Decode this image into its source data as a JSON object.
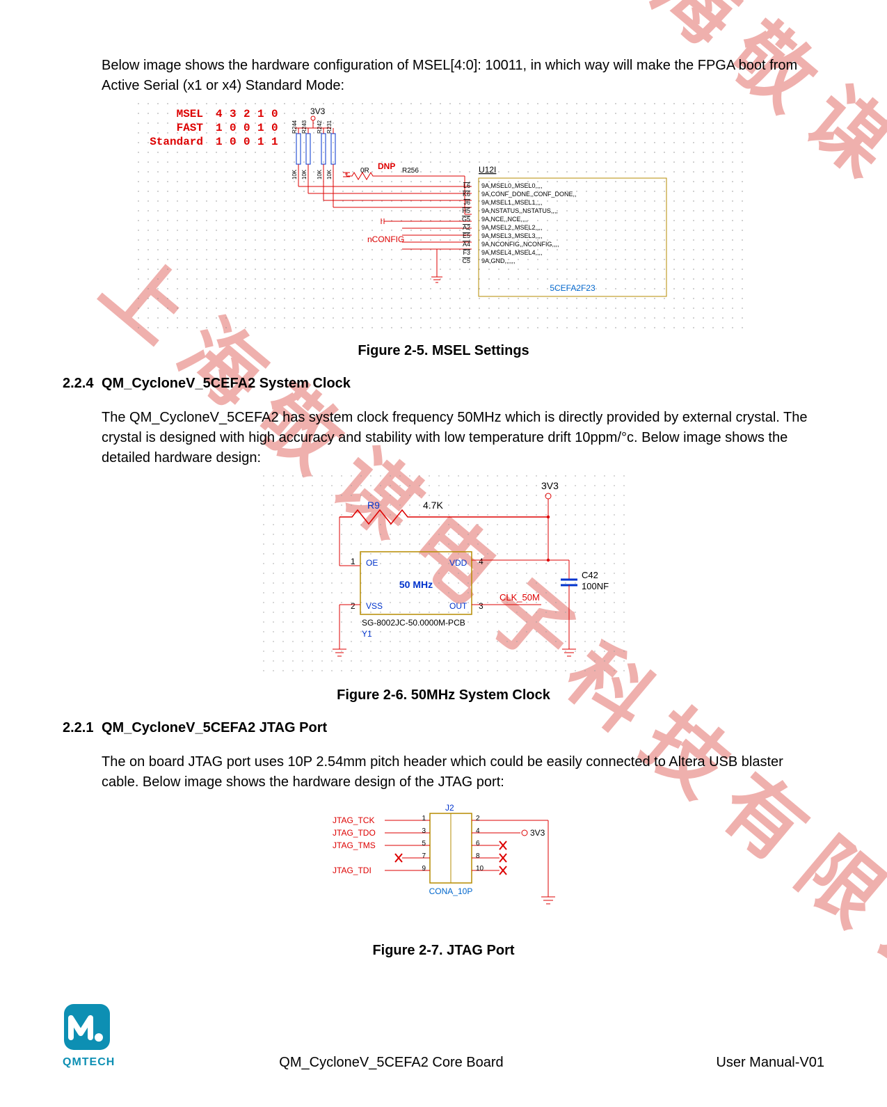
{
  "intro_paragraph": "Below image shows the hardware configuration of MSEL[4:0]: 10011, in which way will make the FPGA boot from Active Serial (x1 or x4) Standard Mode:",
  "msel_diagram": {
    "header": {
      "label": "MSEL",
      "bits": [
        "4",
        "3",
        "2",
        "1",
        "0"
      ]
    },
    "fast": {
      "label": "FAST",
      "bits": [
        "1",
        "0",
        "0",
        "1",
        "0"
      ]
    },
    "std": {
      "label": "Standard",
      "bits": [
        "1",
        "0",
        "0",
        "1",
        "1"
      ]
    },
    "rail": "3V3",
    "resistors": [
      "R244",
      "R243",
      "R242",
      "R231"
    ],
    "res_values": [
      "10K",
      "10K",
      "10K",
      "10K"
    ],
    "dnp_label": "DNP",
    "dnp_res_left": "0R",
    "dnp_res": "R256",
    "nconfig": "nCONFIG",
    "chip_ref": "U12I",
    "chip_pins": [
      {
        "pin": "L6",
        "net": "9A,MSEL0,,MSEL0,,,,"
      },
      {
        "pin": "K6",
        "net": "9A,CONF_DONE,,CONF_DONE,,"
      },
      {
        "pin": "J6",
        "net": "9A,MSEL1,,MSEL1,,,,"
      },
      {
        "pin": "H5",
        "net": "9A,NSTATUS,,NSTATUS,,,,"
      },
      {
        "pin": "G5",
        "net": "9A,NCE,,NCE,,,,"
      },
      {
        "pin": "A2",
        "net": "9A,MSEL2,,MSEL2,,,,"
      },
      {
        "pin": "E5",
        "net": "9A,MSEL3,,MSEL3,,,,"
      },
      {
        "pin": "A4",
        "net": "9A,NCONFIG,,NCONFIG,,,,"
      },
      {
        "pin": "F3",
        "net": "9A,MSEL4,,MSEL4,,,,"
      },
      {
        "pin": "C5",
        "net": "9A,GND,,,,,,"
      }
    ],
    "part_number": "5CEFA2F23"
  },
  "fig25": "Figure 2-5. MSEL Settings",
  "sec224_num": "2.2.4",
  "sec224_title": "QM_CycloneV_5CEFA2 System Clock",
  "sec224_body": "The QM_CycloneV_5CEFA2 has system clock frequency 50MHz which is directly provided by external crystal. The crystal is designed with high accuracy and stability with low temperature drift 10ppm/°c. Below image shows the detailed hardware design:",
  "clock_diagram": {
    "rail": "3V3",
    "r_ref": "R9",
    "r_val": "4.7K",
    "osc": {
      "p1": "OE",
      "p2": "VSS",
      "p3": "OUT",
      "p4": "VDD",
      "freq": "50 MHz",
      "part": "SG-8002JC-50.0000M-PCB",
      "ref": "Y1"
    },
    "cap": {
      "ref": "C42",
      "val": "100NF"
    },
    "net": "CLK_50M",
    "pins": {
      "p1": "1",
      "p2": "2",
      "p3": "3",
      "p4": "4"
    }
  },
  "fig26": "Figure 2-6. 50MHz System Clock",
  "sec221_num": "2.2.1",
  "sec221_title": "QM_CycloneV_5CEFA2 JTAG Port",
  "sec221_body": "The on board JTAG port uses 10P 2.54mm pitch header which could be easily connected to Altera USB blaster cable. Below image shows the hardware design of the JTAG port:",
  "jtag_diagram": {
    "conn_ref": "J2",
    "conn_type": "CONA_10P",
    "signals": [
      "JTAG_TCK",
      "JTAG_TDO",
      "JTAG_TMS",
      "JTAG_TDI"
    ],
    "pins_left": [
      "1",
      "3",
      "5",
      "7",
      "9"
    ],
    "pins_right": [
      "2",
      "4",
      "6",
      "8",
      "10"
    ],
    "rail": "3V3"
  },
  "fig27": "Figure 2-7. JTAG Port",
  "footer_center": "QM_CycloneV_5CEFA2 Core Board",
  "footer_right": "User Manual-V01",
  "logo_text": "QMTECH",
  "watermark": "上海敬谋电子科技有限公司"
}
